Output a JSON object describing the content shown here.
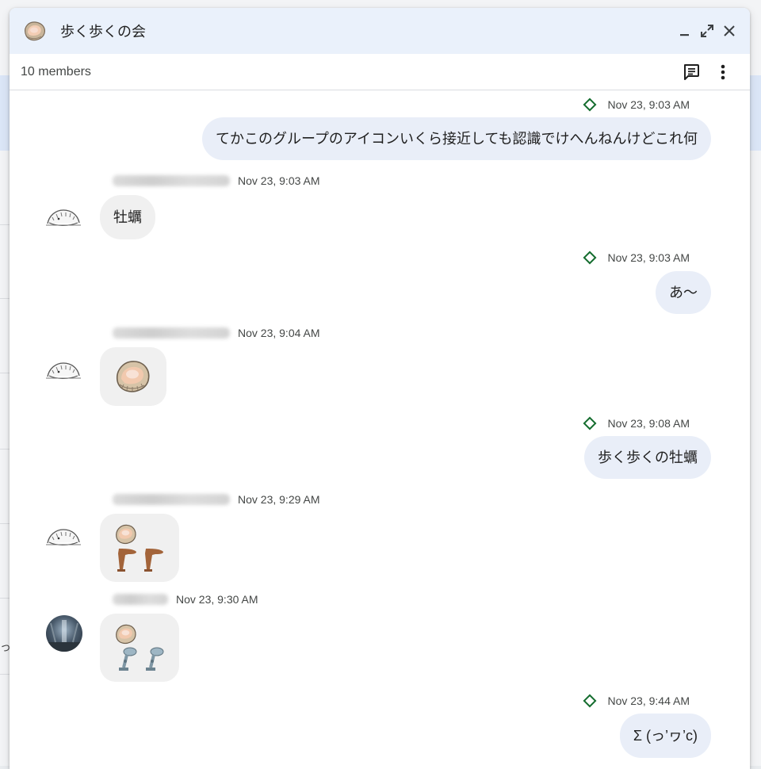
{
  "window": {
    "title": "歩く歩くの会",
    "member_count": "10 members",
    "group_avatar_icon": "oyster-icon",
    "controls": {
      "minimize_icon": "minimize-icon",
      "popout_icon": "expand-icon",
      "close_icon": "close-icon"
    },
    "toolbar": {
      "threads_icon": "threads-icon",
      "more_icon": "more-vert-icon"
    }
  },
  "background": {
    "visible_fragment": "っ!"
  },
  "colors": {
    "sent_bubble": "#e9eef8",
    "received_bubble": "#f0f0f0",
    "title_bar": "#eaf1fb",
    "read_indicator": "#146c2e"
  },
  "messages": [
    {
      "direction": "sent",
      "time": "Nov 23, 9:03 AM",
      "text": "てかこのグループのアイコンいくら接近しても認識でけへんねんけどこれ何"
    },
    {
      "direction": "received",
      "sender_blurred": true,
      "time": "Nov 23, 9:03 AM",
      "text": "牡蠣",
      "avatar": "sketch-avatar-icon"
    },
    {
      "direction": "sent",
      "time": "Nov 23, 9:03 AM",
      "text": "あ〜"
    },
    {
      "direction": "received",
      "sender_blurred": true,
      "time": "Nov 23, 9:04 AM",
      "emoji": [
        "oyster-emoji"
      ],
      "avatar": "sketch-avatar-icon"
    },
    {
      "direction": "sent",
      "time": "Nov 23, 9:08 AM",
      "text": "歩く歩くの牡蠣"
    },
    {
      "direction": "received",
      "sender_blurred": true,
      "time": "Nov 23, 9:29 AM",
      "emoji": [
        "oyster-emoji",
        "leg-emoji",
        "leg-emoji"
      ],
      "avatar": "sketch-avatar-icon"
    },
    {
      "direction": "received",
      "sender_blurred": true,
      "time": "Nov 23, 9:30 AM",
      "emoji": [
        "oyster-emoji",
        "mechanical-leg-emoji",
        "mechanical-leg-emoji"
      ],
      "avatar": "photo-avatar"
    },
    {
      "direction": "sent",
      "time": "Nov 23, 9:44 AM",
      "text": "Σ (っ’ヮ’c)"
    }
  ]
}
